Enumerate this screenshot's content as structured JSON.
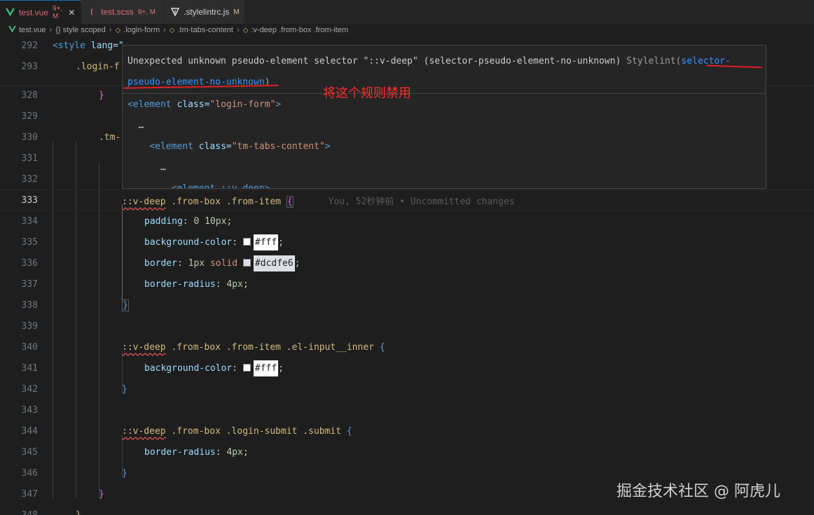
{
  "tabs": [
    {
      "name": "test.vue",
      "status": "9+, M",
      "icon": "vue-icon",
      "active": true
    },
    {
      "name": "test.scss",
      "status": "9+, M",
      "icon": "sass-icon"
    },
    {
      "name": ".stylelintrc.js",
      "status": "M",
      "icon": "stylelint-icon"
    }
  ],
  "breadcrumb": {
    "file": "test.vue",
    "items": [
      "{} style scoped",
      ".login-form",
      ".tm-tabs-content",
      ":v-deep .from-box .from-item"
    ]
  },
  "editor": {
    "line_numbers": [
      "292",
      "293",
      "328",
      "329",
      "330",
      "331",
      "332",
      "333",
      "334",
      "335",
      "336",
      "337",
      "338",
      "339",
      "340",
      "341",
      "342",
      "343",
      "344",
      "345",
      "346",
      "347",
      "348"
    ],
    "l292": {
      "tag": "<style",
      "attr": " lang=\""
    },
    "l293": {
      "text": ".login-f"
    },
    "l328": "}",
    "l330": ".tm-",
    "l333": {
      "deep": "::v-deep",
      "rest": " .from-box .from-item ",
      "brace": "{",
      "blame": "You, 52秒钟前 • Uncommitted changes"
    },
    "l334": {
      "prop": "padding",
      "value": "0 10px"
    },
    "l335": {
      "prop": "background-color",
      "value": "#fff"
    },
    "l336": {
      "prop": "border",
      "value1": "1px",
      "value2": "solid",
      "value3": "#dcdfe6"
    },
    "l337": {
      "prop": "border-radius",
      "value": "4px"
    },
    "l338": "}",
    "l340": {
      "deep": "::v-deep",
      "rest": " .from-box .from-item .el-input__inner ",
      "brace": "{"
    },
    "l341": {
      "prop": "background-color",
      "value": "#fff"
    },
    "l342": "}",
    "l344": {
      "deep": "::v-deep",
      "rest": " .from-box .login-submit .submit ",
      "brace": "{"
    },
    "l345": {
      "prop": "border-radius",
      "value": "4px"
    },
    "l346": "}",
    "l347": "}",
    "l348": "}"
  },
  "hover": {
    "message": "Unexpected unknown pseudo-element selector \"::v-deep\" (selector-pseudo-element-no-unknown)",
    "source": "Stylelint(",
    "link_part1": "selector-",
    "link_part2": "pseudo-element-no-unknown",
    "close_paren": ")",
    "tree1_open": "<element",
    "tree1_attr": " class=",
    "tree1_val": "\"login-form\"",
    "tree1_close": ">",
    "ellipsis1": "…",
    "tree2_open": "<element",
    "tree2_attr": " class=",
    "tree2_val": "\"tm-tabs-content\"",
    "tree2_close": ">",
    "ellipsis2": "…",
    "tree3": "<element ::v-deep>"
  },
  "annotation": "将这个规则禁用",
  "watermark": "掘金技术社区 @ 阿虎儿",
  "colors": {
    "accent": "#0e70c0",
    "error": "#e02020",
    "link": "#3794ff"
  }
}
